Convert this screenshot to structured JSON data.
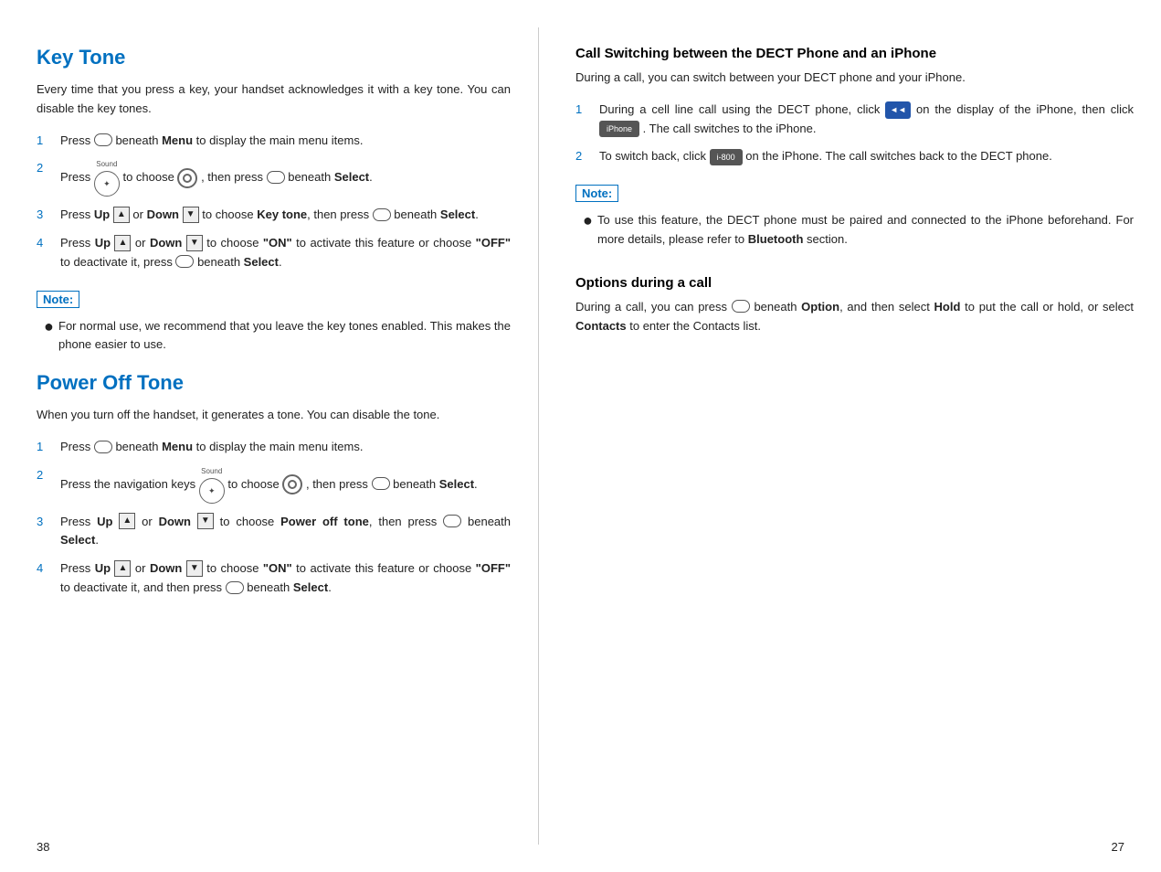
{
  "left": {
    "section1": {
      "title": "Key Tone",
      "intro": "Every time that you press a key, your handset acknowledges it with a key tone. You can disable the key tones.",
      "steps": [
        {
          "num": "1",
          "text_before": "Press",
          "icon_menu": true,
          "text_bold": "Menu",
          "text_after": "to display the main menu items."
        },
        {
          "num": "2",
          "text_before": "Press",
          "icon_nav": true,
          "text_to_choose": "to choose",
          "icon_target": true,
          "text_then": ", then press",
          "icon_menu2": true,
          "text_bold2": "Select",
          "text_after2": "beneath"
        },
        {
          "num": "3",
          "text": "Press Up or Down to choose Key tone, then press beneath Select."
        },
        {
          "num": "4",
          "text": "Press Up or Down to choose \"ON\" to activate this feature or choose \"OFF\" to deactivate it, press beneath Select."
        }
      ],
      "note_label": "Note:",
      "note_bullets": [
        "For normal use, we recommend that you leave the key tones enabled. This makes the phone easier to use."
      ]
    },
    "section2": {
      "title": "Power Off Tone",
      "intro": "When you turn off the handset, it generates a tone. You can disable the tone.",
      "steps": [
        {
          "num": "1",
          "text": "Press beneath Menu to display the main menu items."
        },
        {
          "num": "2",
          "text": "Press the navigation keys to choose , then press beneath Select."
        },
        {
          "num": "3",
          "text": "Press Up or Down to choose Power off tone, then press beneath Select."
        },
        {
          "num": "4",
          "text": "Press Up or Down to choose \"ON\" to activate this feature or choose \"OFF\" to deactivate it, and then press beneath Select."
        }
      ]
    },
    "page_num": "38"
  },
  "right": {
    "section1": {
      "title": "Call Switching between the DECT Phone and an iPhone",
      "intro": "During a call, you can switch between your DECT phone and your iPhone.",
      "steps": [
        {
          "num": "1",
          "text": "During a cell line call using the DECT phone, click on the display of the iPhone, then click . The call switches to the iPhone."
        },
        {
          "num": "2",
          "text": "To switch back, click on the iPhone. The call switches back to the DECT phone."
        }
      ],
      "note_label": "Note:",
      "note_bullets": [
        "To use this feature, the DECT phone must be paired and connected to the iPhone beforehand. For more details, please refer to Bluetooth section."
      ]
    },
    "section2": {
      "title": "Options during a call",
      "text": "During a call, you can press beneath Option, and then select Hold to put the call or hold, or select Contacts to enter the Contacts list."
    },
    "page_num": "27"
  },
  "icons": {
    "menu_button": "○",
    "up_label": "▲",
    "down_label": "▼",
    "sound_label": "Sound",
    "iphone_label": "iPhone",
    "i800_label": "i-800",
    "arrow_left": "◄◄"
  }
}
